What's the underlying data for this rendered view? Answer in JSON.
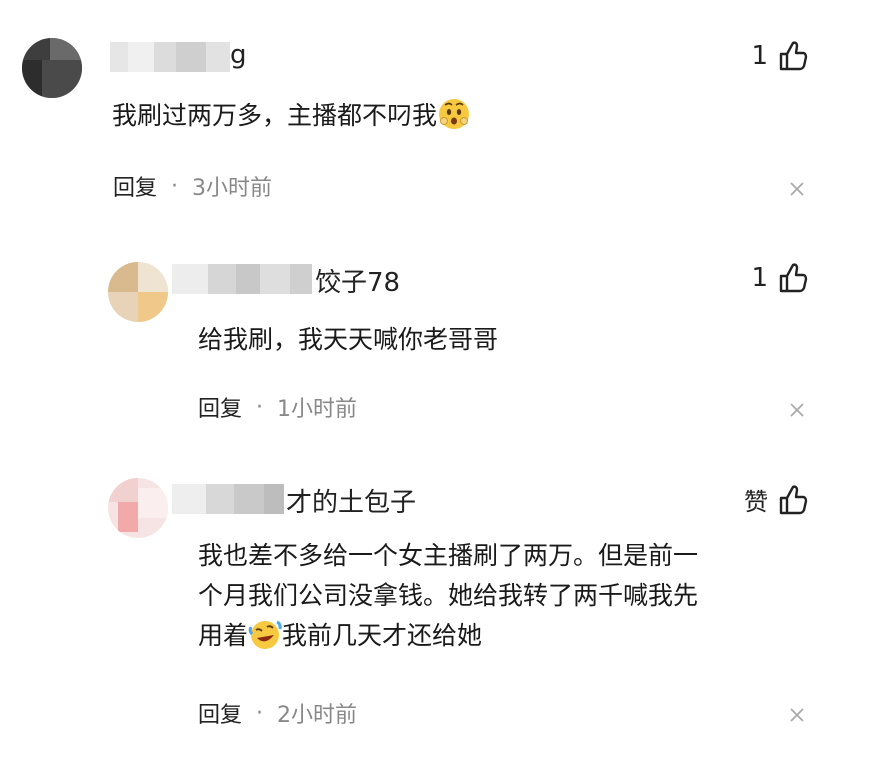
{
  "comments": [
    {
      "username_visible": "g",
      "like_count": "1",
      "text": "我刷过两万多，主播都不叼我",
      "emoji": "shocked-face-emoji",
      "reply_label": "回复",
      "separator": "·",
      "time": "3小时前"
    },
    {
      "username_visible": "饺子78",
      "like_count": "1",
      "text": "给我刷，我天天喊你老哥哥",
      "reply_label": "回复",
      "separator": "·",
      "time": "1小时前"
    },
    {
      "username_visible": "才的土包子",
      "like_label": "赞",
      "text_line1": "我也差不多给一个女主播刷了两万。但是前一",
      "text_line2": "个月我们公司没拿钱。她给我转了两千喊我先",
      "text_line3_before": "用着",
      "emoji": "crying-laughing-face-emoji",
      "text_line3_after": "我前几天才还给她",
      "reply_label": "回复",
      "separator": "·",
      "time": "2小时前"
    }
  ],
  "colors": {
    "text": "#1a1a1a",
    "meta": "#888888",
    "background": "#ffffff"
  }
}
